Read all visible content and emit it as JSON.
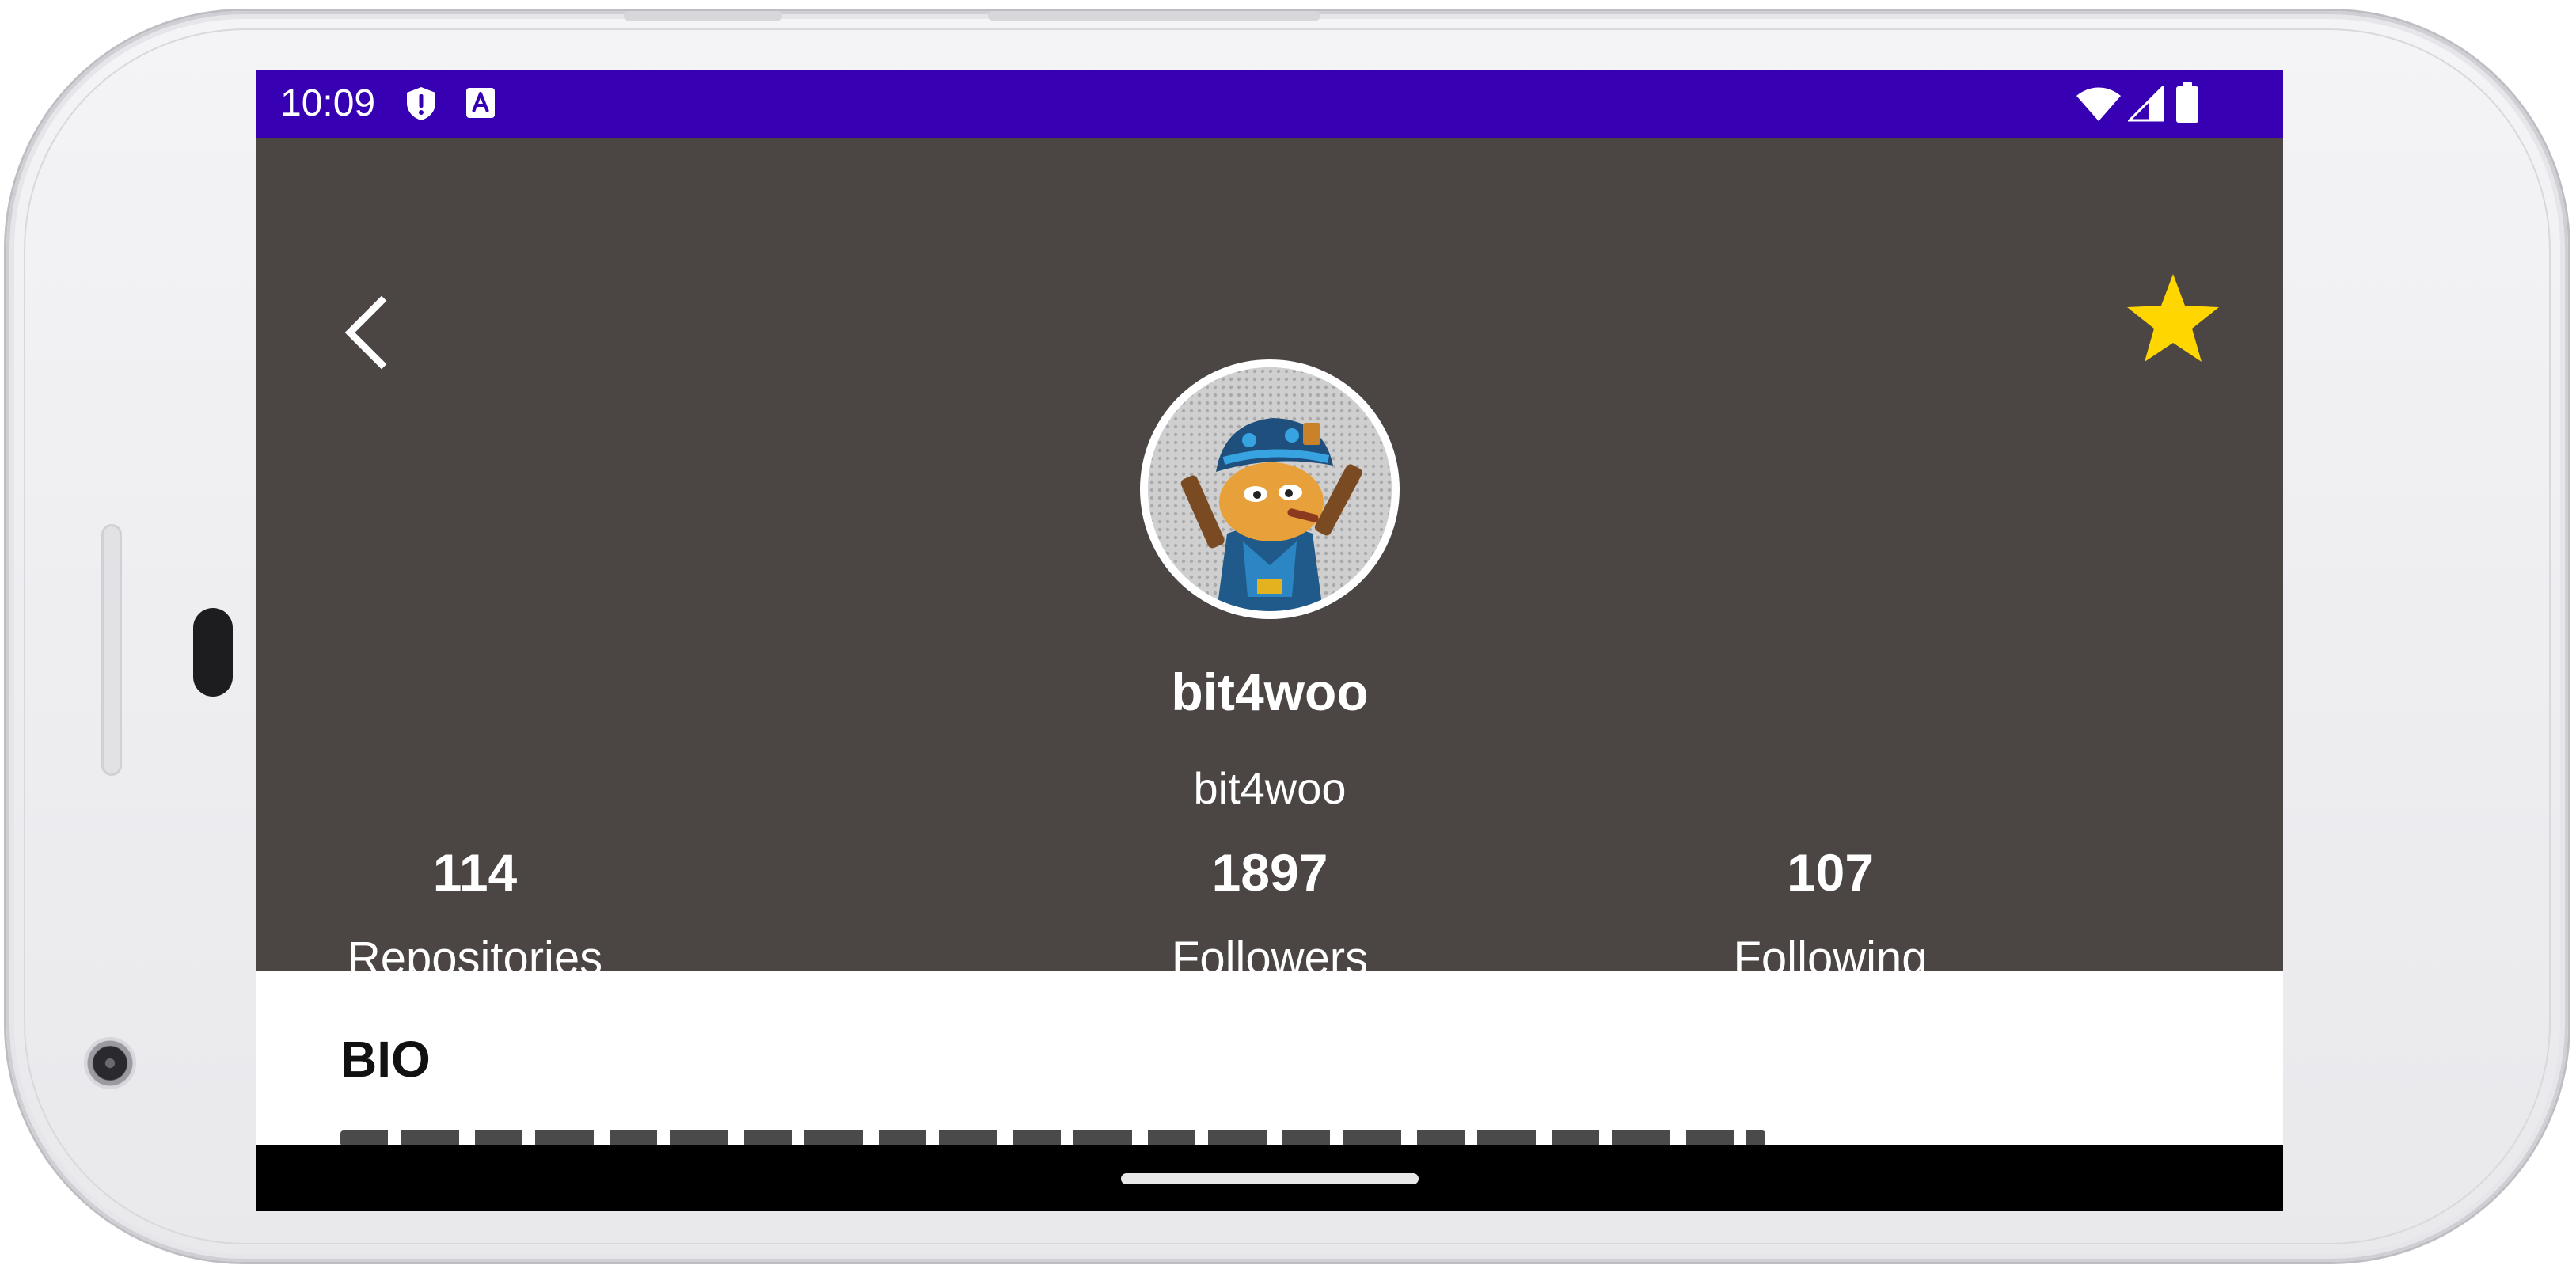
{
  "status_bar": {
    "time": "10:09",
    "left_icons": [
      "shield-alert-icon",
      "keyboard-a-icon"
    ],
    "right_icons": [
      "wifi-icon",
      "cellular-signal-icon",
      "battery-icon"
    ],
    "background_color": "#3700b3"
  },
  "header": {
    "background_color": "#4b4544",
    "back_icon": "chevron-left-icon",
    "favorite_icon": "star-icon",
    "favorite_color": "#ffd600",
    "favorited": true
  },
  "profile": {
    "avatar_description": "game-character-avatar",
    "display_name": "bit4woo",
    "username": "bit4woo"
  },
  "stats": [
    {
      "key": "repositories",
      "value": "114",
      "label": "Repositories"
    },
    {
      "key": "followers",
      "value": "1897",
      "label": "Followers"
    },
    {
      "key": "following",
      "value": "107",
      "label": "Following"
    }
  ],
  "bio": {
    "title": "BIO"
  },
  "nav_bar": {
    "background_color": "#000000",
    "handle": "home-gesture-handle"
  }
}
